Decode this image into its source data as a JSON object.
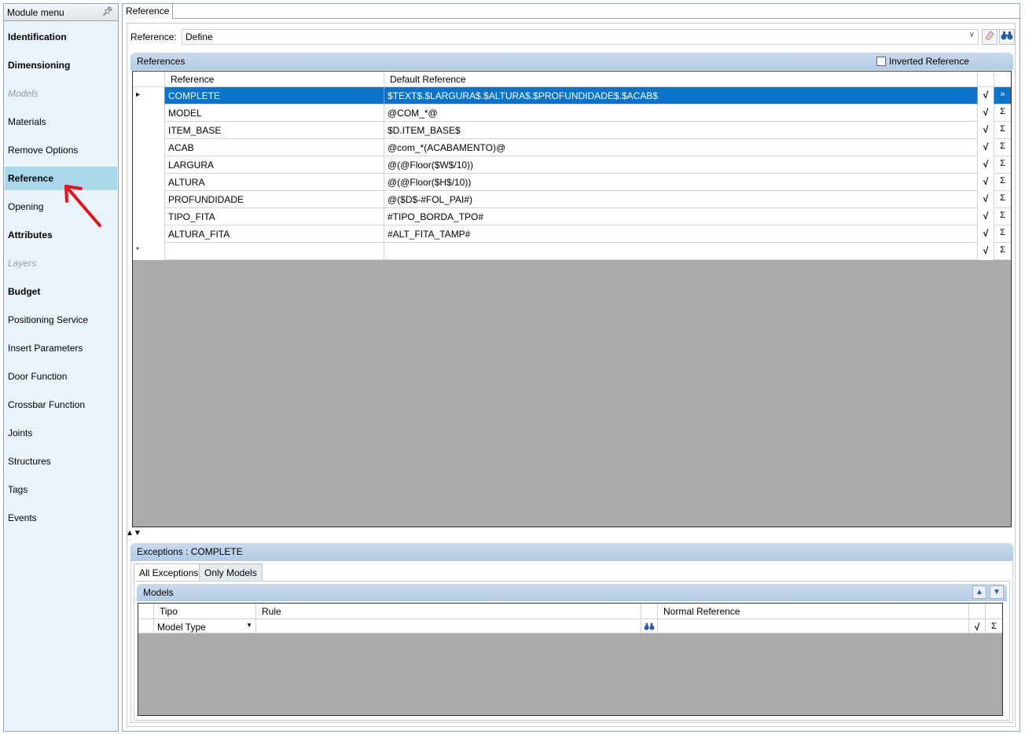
{
  "sidebar": {
    "title": "Module menu",
    "pin_icon": "pin-icon",
    "items": [
      {
        "label": "Identification",
        "style": "bold"
      },
      {
        "label": "Dimensioning",
        "style": "bold"
      },
      {
        "label": "Models",
        "style": "disabled"
      },
      {
        "label": "Materials",
        "style": "normal"
      },
      {
        "label": "Remove Options",
        "style": "normal"
      },
      {
        "label": "Reference",
        "style": "selected"
      },
      {
        "label": "Opening",
        "style": "normal"
      },
      {
        "label": "Attributes",
        "style": "bold"
      },
      {
        "label": "Layers",
        "style": "disabled"
      },
      {
        "label": "Budget",
        "style": "bold"
      },
      {
        "label": "Positioning Service",
        "style": "normal"
      },
      {
        "label": "Insert Parameters",
        "style": "normal"
      },
      {
        "label": "Door Function",
        "style": "normal"
      },
      {
        "label": "Crossbar Function",
        "style": "normal"
      },
      {
        "label": "Joints",
        "style": "normal"
      },
      {
        "label": "Structures",
        "style": "normal"
      },
      {
        "label": "Tags",
        "style": "normal"
      },
      {
        "label": "Events",
        "style": "normal"
      }
    ]
  },
  "main": {
    "tab_label": "Reference",
    "reference_label": "Reference:",
    "reference_value": "Define",
    "references_panel": {
      "title": "References",
      "inverted_label": "Inverted Reference",
      "columns": [
        "Reference",
        "Default Reference"
      ],
      "rows": [
        {
          "reference": "COMPLETE",
          "default": "$TEXT$.$LARGURA$.$ALTURA$.$PROFUNDIDADE$.$ACAB$"
        },
        {
          "reference": "MODEL",
          "default": "@COM_*@"
        },
        {
          "reference": "ITEM_BASE",
          "default": "$D.ITEM_BASE$"
        },
        {
          "reference": "ACAB",
          "default": "@com_*(ACABAMENTO)@"
        },
        {
          "reference": "LARGURA",
          "default": "@(@Floor($W$/10))"
        },
        {
          "reference": "ALTURA",
          "default": "@(@Floor($H$/10))"
        },
        {
          "reference": "PROFUNDIDADE",
          "default": "@($D$-#FOL_PAI#)"
        },
        {
          "reference": "TIPO_FITA",
          "default": "#TIPO_BORDA_TPO#"
        },
        {
          "reference": "ALTURA_FITA",
          "default": "#ALT_FITA_TAMP#"
        }
      ],
      "new_row_marker": "*"
    },
    "splitter_glyph": "▲▼",
    "exceptions": {
      "title": "Exceptions : COMPLETE",
      "tabs": [
        "All Exceptions",
        "Only Models"
      ],
      "models_title": "Models",
      "columns": [
        "Tipo",
        "Rule",
        "Normal Reference"
      ],
      "row": {
        "tipo": "Model Type",
        "rule": "",
        "normal_reference": ""
      }
    }
  }
}
